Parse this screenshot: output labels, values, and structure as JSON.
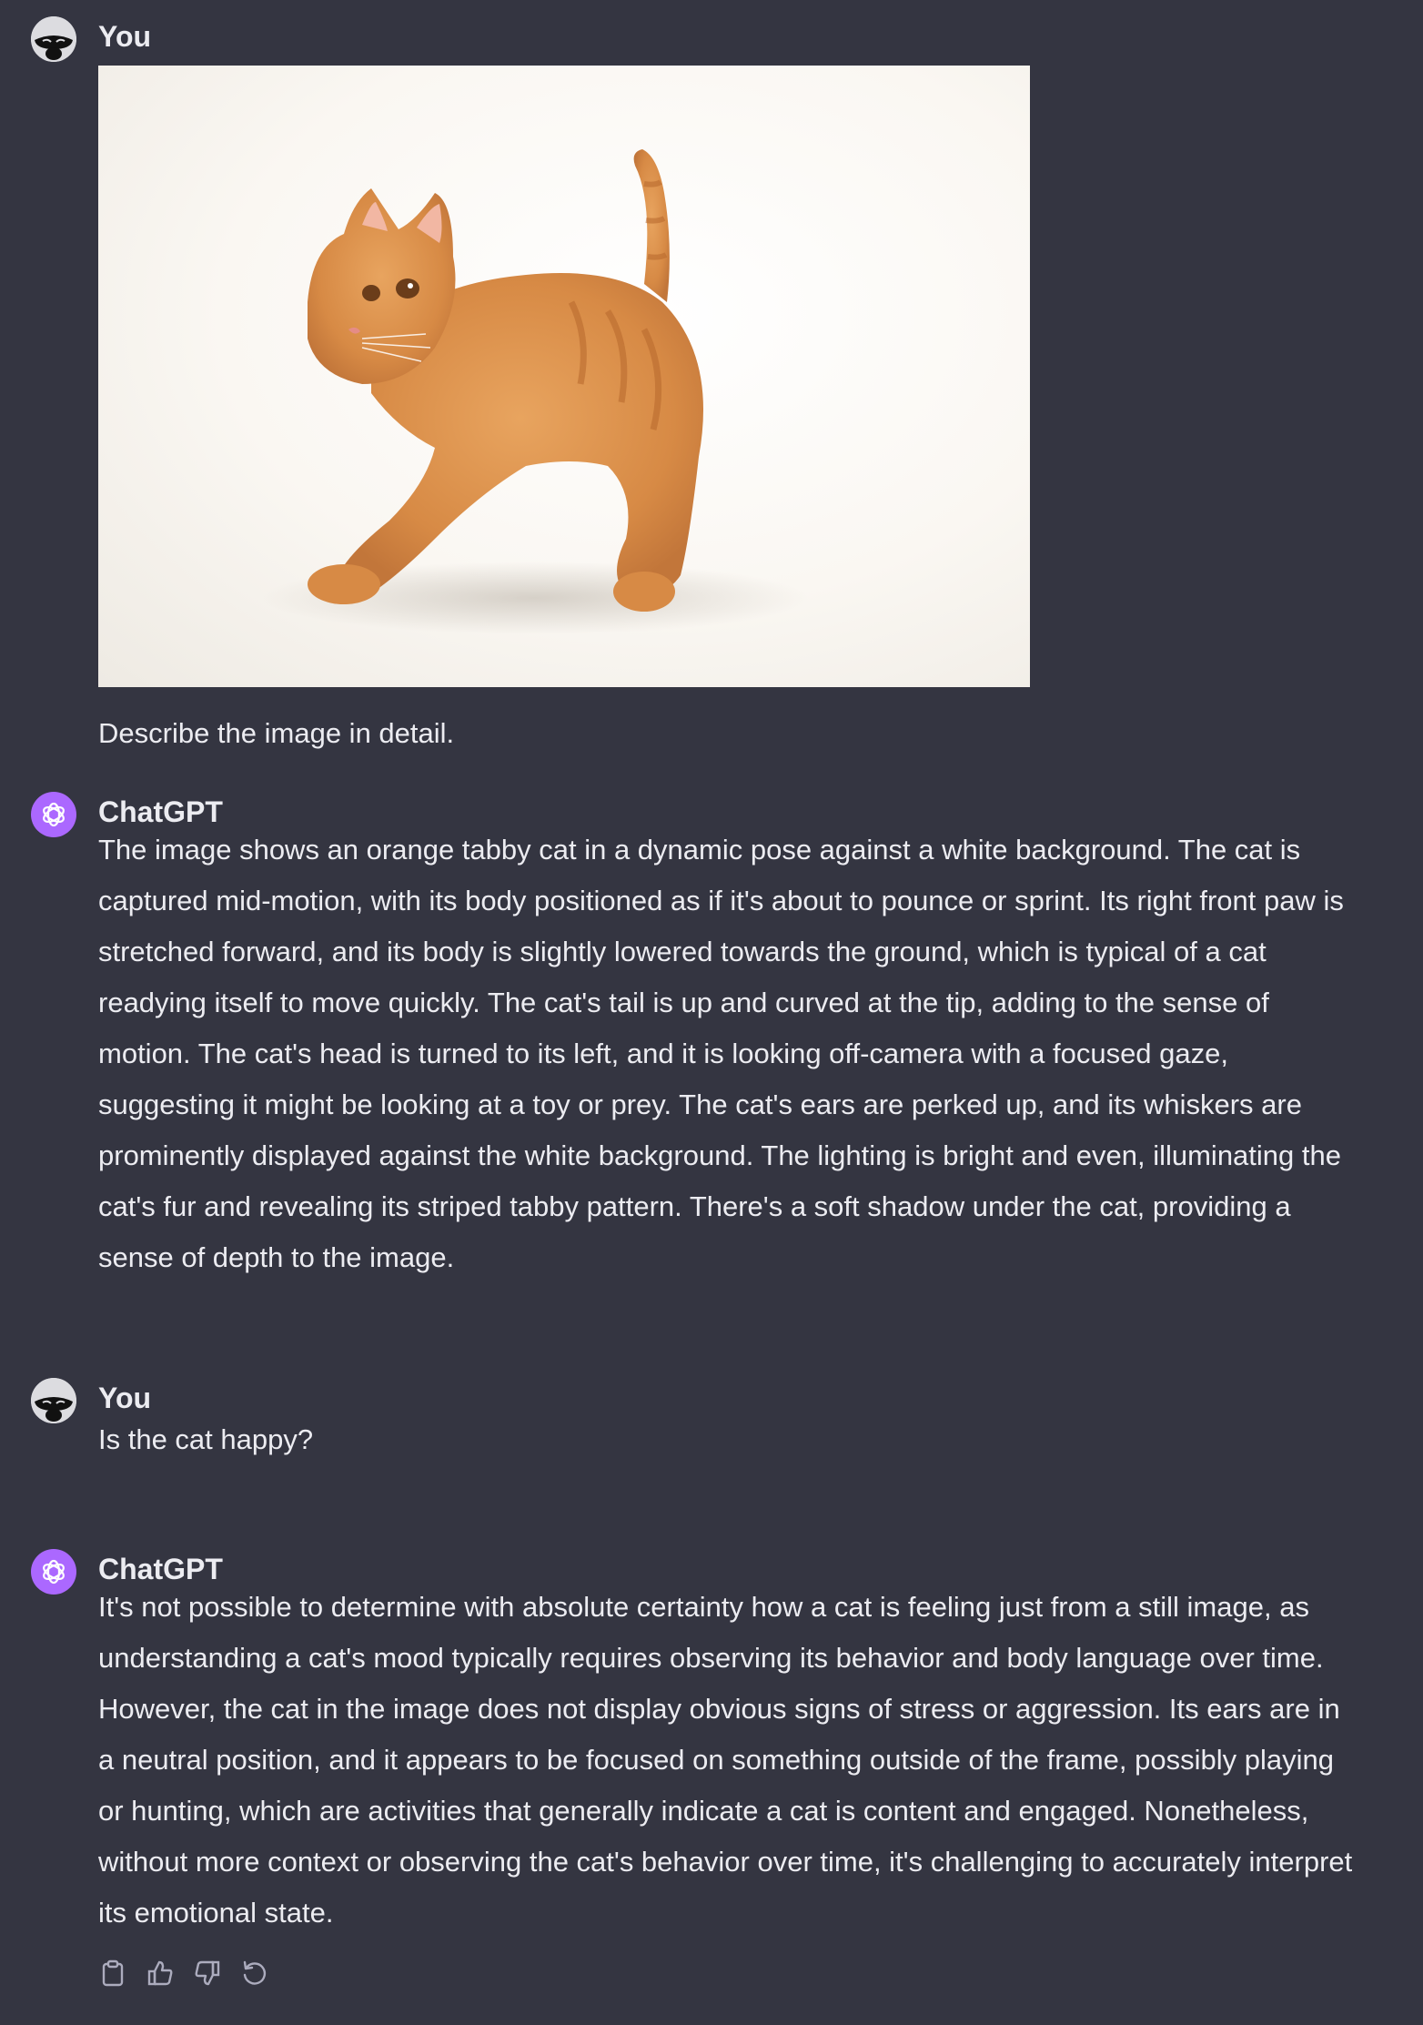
{
  "conversation": [
    {
      "role": "user",
      "author": "You",
      "has_image": true,
      "text": "Describe the image in detail."
    },
    {
      "role": "assistant",
      "author": "ChatGPT",
      "text": "The image shows an orange tabby cat in a dynamic pose against a white background. The cat is captured mid-motion, with its body positioned as if it's about to pounce or sprint. Its right front paw is stretched forward, and its body is slightly lowered towards the ground, which is typical of a cat readying itself to move quickly. The cat's tail is up and curved at the tip, adding to the sense of motion. The cat's head is turned to its left, and it is looking off-camera with a focused gaze, suggesting it might be looking at a toy or prey. The cat's ears are perked up, and its whiskers are prominently displayed against the white background. The lighting is bright and even, illuminating the cat's fur and revealing its striped tabby pattern. There's a soft shadow under the cat, providing a sense of depth to the image."
    },
    {
      "role": "user",
      "author": "You",
      "text": "Is the cat happy?"
    },
    {
      "role": "assistant",
      "author": "ChatGPT",
      "text": "It's not possible to determine with absolute certainty how a cat is feeling just from a still image, as understanding a cat's mood typically requires observing its behavior and body language over time. However, the cat in the image does not display obvious signs of stress or aggression. Its ears are in a neutral position, and it appears to be focused on something outside of the frame, possibly playing or hunting, which are activities that generally indicate a cat is content and engaged. Nonetheless, without more context or observing the cat's behavior over time, it's challenging to accurately interpret its emotional state."
    }
  ],
  "message_actions": [
    "clipboard-icon",
    "thumbs-up-icon",
    "thumbs-down-icon",
    "regenerate-icon"
  ],
  "colors": {
    "background": "#343541",
    "text": "#ececf1",
    "assistant_avatar": "#ab68ff",
    "icon": "#acacbe"
  }
}
